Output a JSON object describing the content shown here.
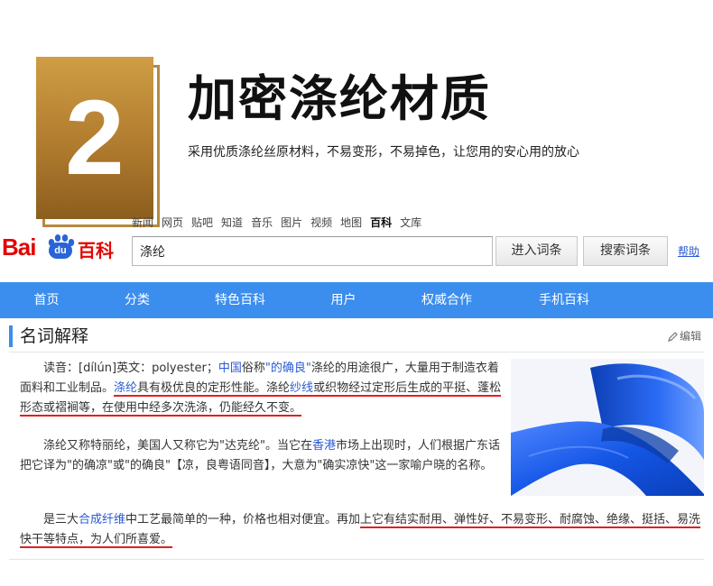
{
  "hero": {
    "number": "2",
    "title": "加密涤纶材质",
    "subtitle": "采用优质涤纶丝原材料，不易变形，不易掉色，让您用的安心用的放心"
  },
  "baidu": {
    "top_links": [
      "新闻",
      "网页",
      "贴吧",
      "知道",
      "音乐",
      "图片",
      "视频",
      "地图",
      "百科",
      "文库"
    ],
    "active_link": "百科",
    "logo": {
      "bai": "Bai",
      "du": "du",
      "baike": "百科"
    },
    "search_value": "涤纶",
    "enter_button": "进入词条",
    "search_button": "搜索词条",
    "help_link": "帮助",
    "nav": [
      "首页",
      "分类",
      "特色百科",
      "用户",
      "权威合作",
      "手机百科"
    ],
    "section_title": "名词解释",
    "edit_label": "编辑",
    "brand_colors": {
      "red": "#e10602",
      "blue": "#3b8eee",
      "link": "#2a5ad3",
      "underline": "#e02020"
    }
  },
  "article": {
    "p1": {
      "t1": "读音：[dílún]英文：polyester；",
      "l1": "中国",
      "t2": "俗称",
      "l2": "\"的确良\"",
      "t3": "涤纶的用途很广，大量用于制造衣着面料和工业制品。",
      "l3": "涤纶",
      "t4": "具有极优良的定形性能。涤纶",
      "l4": "纱线",
      "t5": "或织物经过定形后生成的平挺、蓬松形态或褶裥等，在使用中经多次洗涤，仍能经久不变。"
    },
    "p2": {
      "t1": "涤纶又称特丽纶，美国人又称它为\"达克纶\"。当它在",
      "l1": "香港",
      "t2": "市场上出现时，人们根据广东话把它译为\"的确凉\"或\"的确良\"【凉，良粤语同音】，大意为\"确实凉快\"这一家喻户晓的名称。"
    },
    "p3": {
      "t1": "是三大",
      "l1": "合成纤维",
      "t2": "中工艺最简单的一种，价格也相对便宜。再加",
      "u1": "上它有结实耐用、弹性好、不易变形、耐腐蚀、绝缘、挺括、易洗快干等特点，为人们所喜爱。"
    }
  }
}
